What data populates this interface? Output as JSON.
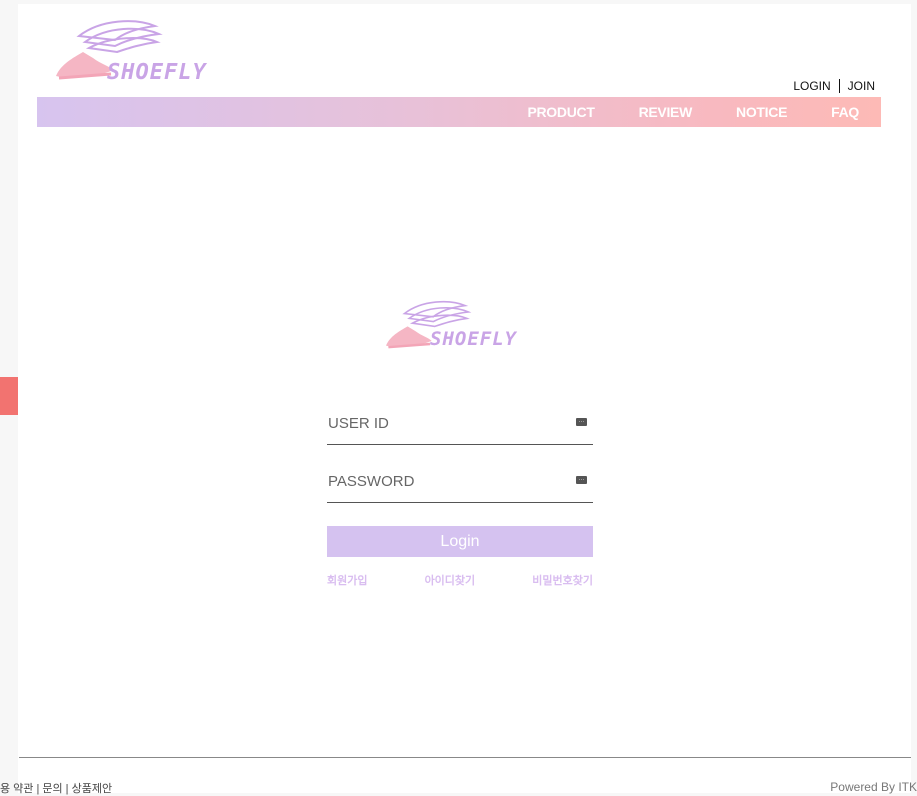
{
  "header": {
    "brand": "SHOEFLY",
    "top_links": {
      "login": "LOGIN",
      "join": "JOIN"
    },
    "nav": [
      "PRODUCT",
      "REVIEW",
      "NOTICE",
      "FAQ"
    ]
  },
  "login": {
    "brand": "SHOEFLY",
    "user_id_placeholder": "USER ID",
    "password_placeholder": "PASSWORD",
    "button_label": "Login",
    "links": {
      "signup": "회원가입",
      "find_id": "아이디찾기",
      "find_password": "비밀번호찾기"
    }
  },
  "footer": {
    "left_text": "용 약관 | 문의 | 상품제안",
    "right_text": "Powered By ITK"
  },
  "colors": {
    "nav_gradient_start": "#d7c4ef",
    "nav_gradient_end": "#fdbab6",
    "button_bg": "#d5c2f0",
    "link_color": "#d9bdf0",
    "arrow": "#f07070"
  },
  "icons": [
    "winged-shoe-logo-icon",
    "keyboard-icon",
    "arrow-right-icon"
  ]
}
